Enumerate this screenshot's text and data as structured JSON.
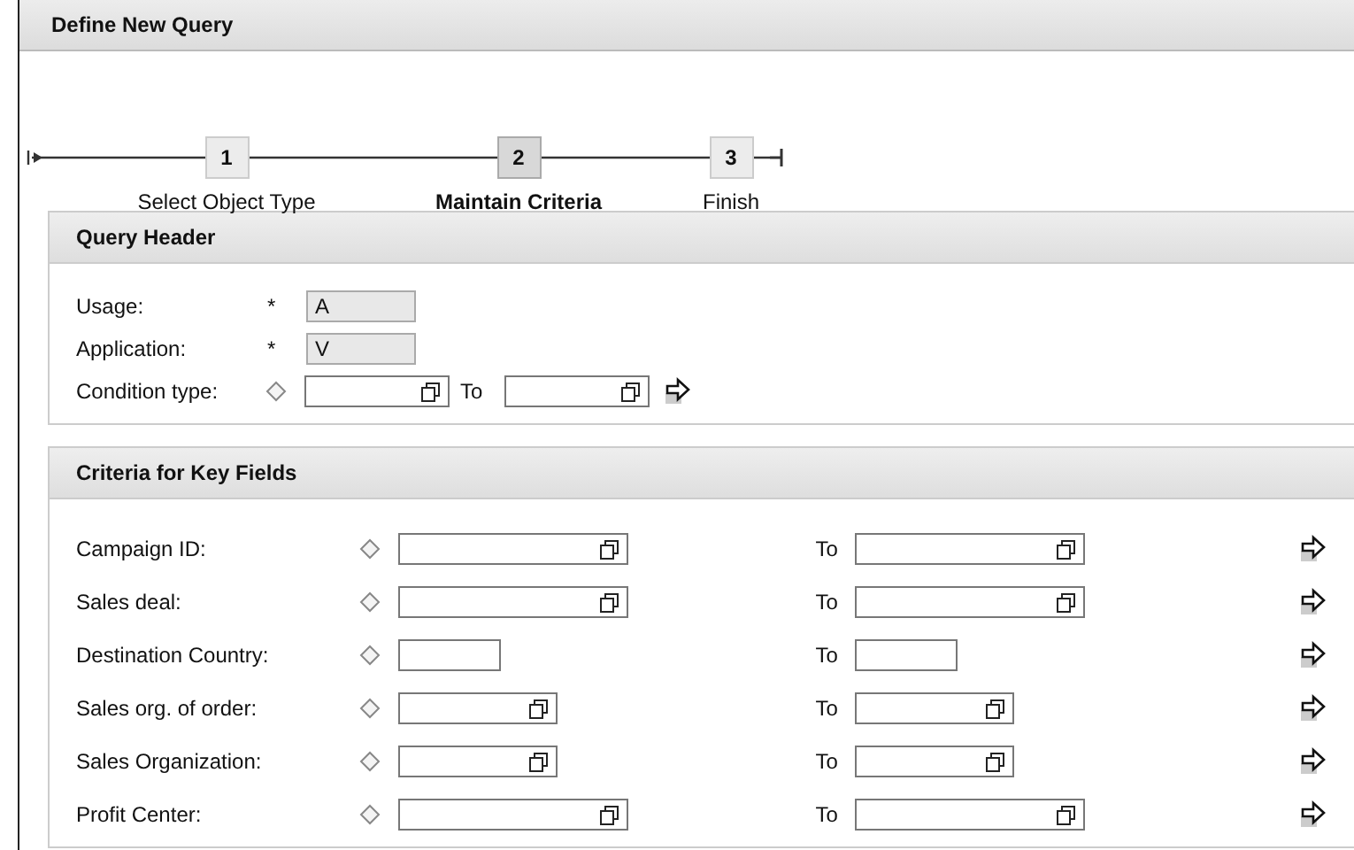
{
  "window": {
    "title": "Define New Query"
  },
  "steps": [
    {
      "number": "1",
      "label": "Select Object Type",
      "selected": false
    },
    {
      "number": "2",
      "label": "Maintain Criteria",
      "selected": true
    },
    {
      "number": "3",
      "label": "Finish",
      "selected": false
    }
  ],
  "query_header": {
    "title": "Query Header",
    "fields": [
      {
        "label": "Usage:",
        "required_mark": "*",
        "value": "A",
        "disabled": true
      },
      {
        "label": "Application:",
        "required_mark": "*",
        "value": "V",
        "disabled": true
      }
    ],
    "range": {
      "label": "Condition type:",
      "to_label": "To"
    }
  },
  "criteria": {
    "title": "Criteria for Key Fields",
    "rows": [
      {
        "label": "Campaign ID:",
        "kind": "wide",
        "to_label": "To"
      },
      {
        "label": "Sales deal:",
        "kind": "wide",
        "to_label": "To"
      },
      {
        "label": "Destination Country:",
        "kind": "narrow",
        "to_label": "To"
      },
      {
        "label": "Sales org. of order:",
        "kind": "medium",
        "to_label": "To"
      },
      {
        "label": "Sales Organization:",
        "kind": "medium",
        "to_label": "To"
      },
      {
        "label": "Profit Center:",
        "kind": "wide",
        "to_label": "To"
      }
    ]
  }
}
